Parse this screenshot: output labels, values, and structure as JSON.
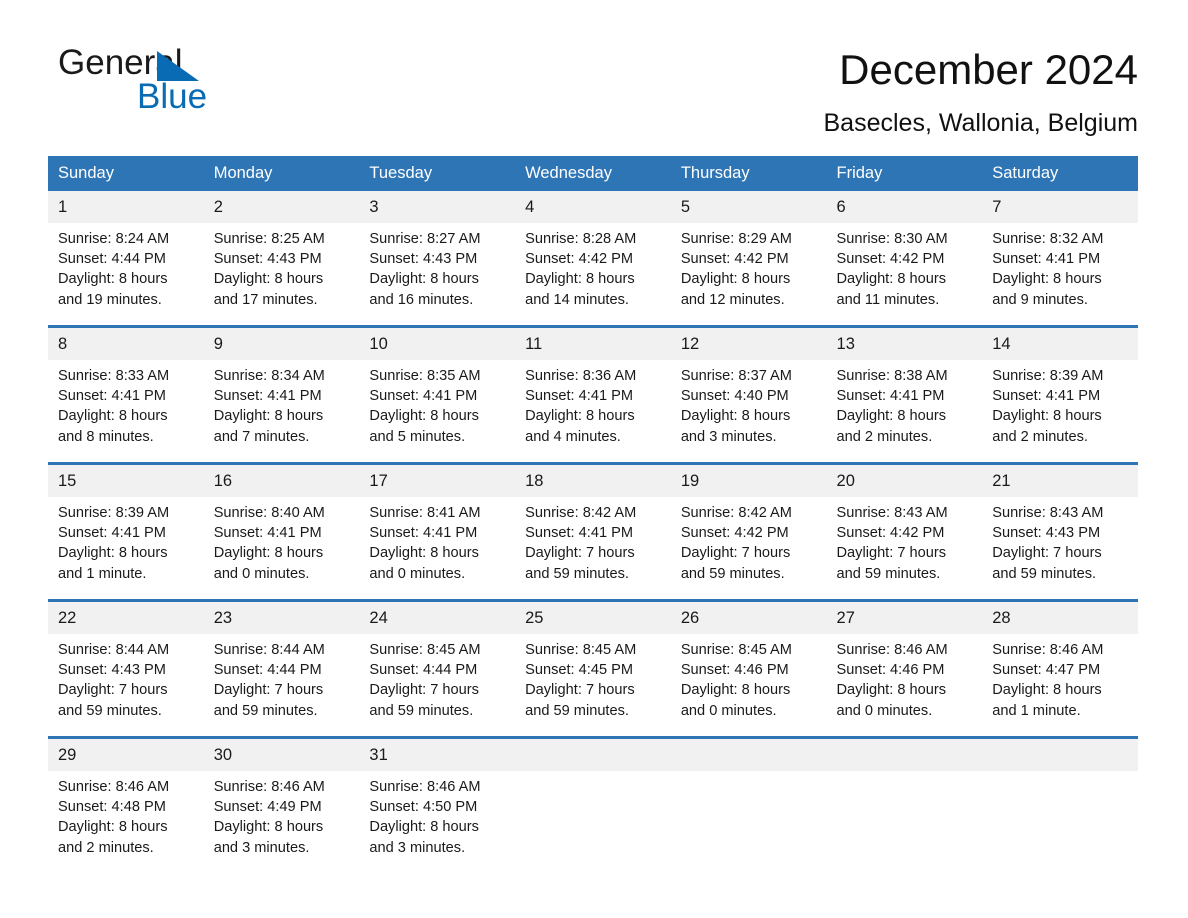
{
  "logo": {
    "word1": "General",
    "word2": "Blue",
    "accent_color": "#0a6bb5",
    "triangle_icon": "triangle-icon"
  },
  "header": {
    "title": "December 2024",
    "subtitle": "Basecles, Wallonia, Belgium"
  },
  "theme": {
    "header_blue": "#2e75b6",
    "daynum_gray": "#f1f1f1",
    "text": "#1a1a1a"
  },
  "calendar": {
    "weekday_headers": [
      "Sunday",
      "Monday",
      "Tuesday",
      "Wednesday",
      "Thursday",
      "Friday",
      "Saturday"
    ],
    "weeks": [
      [
        {
          "day": "1",
          "sunrise": "Sunrise: 8:24 AM",
          "sunset": "Sunset: 4:44 PM",
          "daylight1": "Daylight: 8 hours",
          "daylight2": "and 19 minutes."
        },
        {
          "day": "2",
          "sunrise": "Sunrise: 8:25 AM",
          "sunset": "Sunset: 4:43 PM",
          "daylight1": "Daylight: 8 hours",
          "daylight2": "and 17 minutes."
        },
        {
          "day": "3",
          "sunrise": "Sunrise: 8:27 AM",
          "sunset": "Sunset: 4:43 PM",
          "daylight1": "Daylight: 8 hours",
          "daylight2": "and 16 minutes."
        },
        {
          "day": "4",
          "sunrise": "Sunrise: 8:28 AM",
          "sunset": "Sunset: 4:42 PM",
          "daylight1": "Daylight: 8 hours",
          "daylight2": "and 14 minutes."
        },
        {
          "day": "5",
          "sunrise": "Sunrise: 8:29 AM",
          "sunset": "Sunset: 4:42 PM",
          "daylight1": "Daylight: 8 hours",
          "daylight2": "and 12 minutes."
        },
        {
          "day": "6",
          "sunrise": "Sunrise: 8:30 AM",
          "sunset": "Sunset: 4:42 PM",
          "daylight1": "Daylight: 8 hours",
          "daylight2": "and 11 minutes."
        },
        {
          "day": "7",
          "sunrise": "Sunrise: 8:32 AM",
          "sunset": "Sunset: 4:41 PM",
          "daylight1": "Daylight: 8 hours",
          "daylight2": "and 9 minutes."
        }
      ],
      [
        {
          "day": "8",
          "sunrise": "Sunrise: 8:33 AM",
          "sunset": "Sunset: 4:41 PM",
          "daylight1": "Daylight: 8 hours",
          "daylight2": "and 8 minutes."
        },
        {
          "day": "9",
          "sunrise": "Sunrise: 8:34 AM",
          "sunset": "Sunset: 4:41 PM",
          "daylight1": "Daylight: 8 hours",
          "daylight2": "and 7 minutes."
        },
        {
          "day": "10",
          "sunrise": "Sunrise: 8:35 AM",
          "sunset": "Sunset: 4:41 PM",
          "daylight1": "Daylight: 8 hours",
          "daylight2": "and 5 minutes."
        },
        {
          "day": "11",
          "sunrise": "Sunrise: 8:36 AM",
          "sunset": "Sunset: 4:41 PM",
          "daylight1": "Daylight: 8 hours",
          "daylight2": "and 4 minutes."
        },
        {
          "day": "12",
          "sunrise": "Sunrise: 8:37 AM",
          "sunset": "Sunset: 4:40 PM",
          "daylight1": "Daylight: 8 hours",
          "daylight2": "and 3 minutes."
        },
        {
          "day": "13",
          "sunrise": "Sunrise: 8:38 AM",
          "sunset": "Sunset: 4:41 PM",
          "daylight1": "Daylight: 8 hours",
          "daylight2": "and 2 minutes."
        },
        {
          "day": "14",
          "sunrise": "Sunrise: 8:39 AM",
          "sunset": "Sunset: 4:41 PM",
          "daylight1": "Daylight: 8 hours",
          "daylight2": "and 2 minutes."
        }
      ],
      [
        {
          "day": "15",
          "sunrise": "Sunrise: 8:39 AM",
          "sunset": "Sunset: 4:41 PM",
          "daylight1": "Daylight: 8 hours",
          "daylight2": "and 1 minute."
        },
        {
          "day": "16",
          "sunrise": "Sunrise: 8:40 AM",
          "sunset": "Sunset: 4:41 PM",
          "daylight1": "Daylight: 8 hours",
          "daylight2": "and 0 minutes."
        },
        {
          "day": "17",
          "sunrise": "Sunrise: 8:41 AM",
          "sunset": "Sunset: 4:41 PM",
          "daylight1": "Daylight: 8 hours",
          "daylight2": "and 0 minutes."
        },
        {
          "day": "18",
          "sunrise": "Sunrise: 8:42 AM",
          "sunset": "Sunset: 4:41 PM",
          "daylight1": "Daylight: 7 hours",
          "daylight2": "and 59 minutes."
        },
        {
          "day": "19",
          "sunrise": "Sunrise: 8:42 AM",
          "sunset": "Sunset: 4:42 PM",
          "daylight1": "Daylight: 7 hours",
          "daylight2": "and 59 minutes."
        },
        {
          "day": "20",
          "sunrise": "Sunrise: 8:43 AM",
          "sunset": "Sunset: 4:42 PM",
          "daylight1": "Daylight: 7 hours",
          "daylight2": "and 59 minutes."
        },
        {
          "day": "21",
          "sunrise": "Sunrise: 8:43 AM",
          "sunset": "Sunset: 4:43 PM",
          "daylight1": "Daylight: 7 hours",
          "daylight2": "and 59 minutes."
        }
      ],
      [
        {
          "day": "22",
          "sunrise": "Sunrise: 8:44 AM",
          "sunset": "Sunset: 4:43 PM",
          "daylight1": "Daylight: 7 hours",
          "daylight2": "and 59 minutes."
        },
        {
          "day": "23",
          "sunrise": "Sunrise: 8:44 AM",
          "sunset": "Sunset: 4:44 PM",
          "daylight1": "Daylight: 7 hours",
          "daylight2": "and 59 minutes."
        },
        {
          "day": "24",
          "sunrise": "Sunrise: 8:45 AM",
          "sunset": "Sunset: 4:44 PM",
          "daylight1": "Daylight: 7 hours",
          "daylight2": "and 59 minutes."
        },
        {
          "day": "25",
          "sunrise": "Sunrise: 8:45 AM",
          "sunset": "Sunset: 4:45 PM",
          "daylight1": "Daylight: 7 hours",
          "daylight2": "and 59 minutes."
        },
        {
          "day": "26",
          "sunrise": "Sunrise: 8:45 AM",
          "sunset": "Sunset: 4:46 PM",
          "daylight1": "Daylight: 8 hours",
          "daylight2": "and 0 minutes."
        },
        {
          "day": "27",
          "sunrise": "Sunrise: 8:46 AM",
          "sunset": "Sunset: 4:46 PM",
          "daylight1": "Daylight: 8 hours",
          "daylight2": "and 0 minutes."
        },
        {
          "day": "28",
          "sunrise": "Sunrise: 8:46 AM",
          "sunset": "Sunset: 4:47 PM",
          "daylight1": "Daylight: 8 hours",
          "daylight2": "and 1 minute."
        }
      ],
      [
        {
          "day": "29",
          "sunrise": "Sunrise: 8:46 AM",
          "sunset": "Sunset: 4:48 PM",
          "daylight1": "Daylight: 8 hours",
          "daylight2": "and 2 minutes."
        },
        {
          "day": "30",
          "sunrise": "Sunrise: 8:46 AM",
          "sunset": "Sunset: 4:49 PM",
          "daylight1": "Daylight: 8 hours",
          "daylight2": "and 3 minutes."
        },
        {
          "day": "31",
          "sunrise": "Sunrise: 8:46 AM",
          "sunset": "Sunset: 4:50 PM",
          "daylight1": "Daylight: 8 hours",
          "daylight2": "and 3 minutes."
        },
        {
          "day": "",
          "sunrise": "",
          "sunset": "",
          "daylight1": "",
          "daylight2": ""
        },
        {
          "day": "",
          "sunrise": "",
          "sunset": "",
          "daylight1": "",
          "daylight2": ""
        },
        {
          "day": "",
          "sunrise": "",
          "sunset": "",
          "daylight1": "",
          "daylight2": ""
        },
        {
          "day": "",
          "sunrise": "",
          "sunset": "",
          "daylight1": "",
          "daylight2": ""
        }
      ]
    ]
  }
}
